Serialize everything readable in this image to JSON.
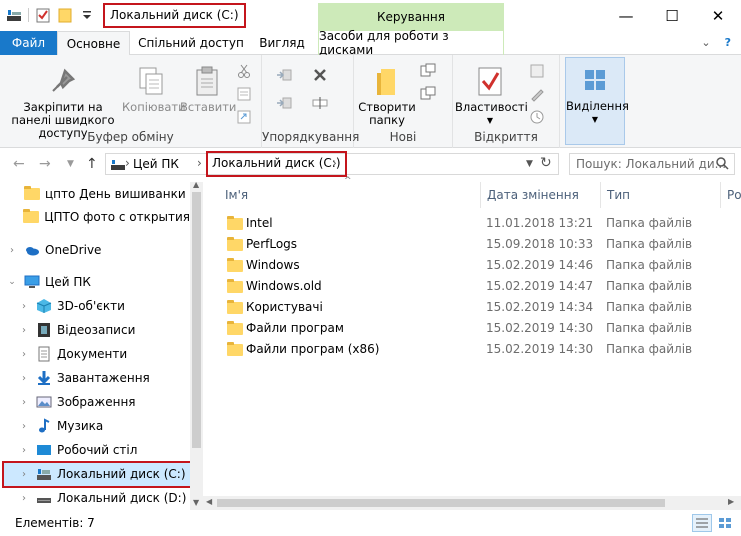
{
  "window": {
    "title": "Локальний диск (C:)",
    "context_tab_title": "Керування",
    "controls": {
      "minimize": "—",
      "maximize": "☐",
      "close": "✕"
    }
  },
  "ribbon_tabs": {
    "file": "Файл",
    "home": "Основне",
    "share": "Спільний доступ",
    "view": "Вигляд",
    "disk_tools": "Засоби для роботи з дисками",
    "collapse": "⌄",
    "help": "?"
  },
  "ribbon": {
    "clipboard": {
      "label": "Буфер обміну",
      "pin": "Закріпити на панелі швидкого доступу",
      "copy": "Копіювати",
      "paste": "Вставити"
    },
    "organize": {
      "label": "Упорядкування"
    },
    "new": {
      "label": "Нові",
      "new_folder": "Створити папку"
    },
    "open": {
      "label": "Відкриття",
      "properties": "Властивості"
    },
    "select": {
      "label": "Виділення"
    }
  },
  "address": {
    "root": "Цей ПК",
    "current": "Локальний диск (C:)",
    "search_placeholder": "Пошук: Локальний ди..."
  },
  "nav": {
    "items": [
      {
        "label": "цпто День вишиванки",
        "icon": "folder-icon"
      },
      {
        "label": "ЦПТО фото с открытия",
        "icon": "folder-icon"
      },
      {
        "label": "OneDrive",
        "icon": "onedrive-icon"
      },
      {
        "label": "Цей ПК",
        "icon": "pc-icon"
      },
      {
        "label": "3D-об'єкти",
        "icon": "3d-objects-icon"
      },
      {
        "label": "Відеозаписи",
        "icon": "video-icon"
      },
      {
        "label": "Документи",
        "icon": "documents-icon"
      },
      {
        "label": "Завантаження",
        "icon": "downloads-icon"
      },
      {
        "label": "Зображення",
        "icon": "pictures-icon"
      },
      {
        "label": "Музика",
        "icon": "music-icon"
      },
      {
        "label": "Робочий стіл",
        "icon": "desktop-icon"
      },
      {
        "label": "Локальний диск (C:)",
        "icon": "drive-c-icon"
      },
      {
        "label": "Локальний диск (D:)",
        "icon": "drive-d-icon"
      }
    ]
  },
  "files": {
    "columns": {
      "name": "Ім'я",
      "date": "Дата змінення",
      "type": "Тип",
      "size": "Ро"
    },
    "rows": [
      {
        "name": "Intel",
        "date": "11.01.2018 13:21",
        "type": "Папка файлів"
      },
      {
        "name": "PerfLogs",
        "date": "15.09.2018 10:33",
        "type": "Папка файлів"
      },
      {
        "name": "Windows",
        "date": "15.02.2019 14:46",
        "type": "Папка файлів"
      },
      {
        "name": "Windows.old",
        "date": "15.02.2019 14:47",
        "type": "Папка файлів"
      },
      {
        "name": "Користувачі",
        "date": "15.02.2019 14:34",
        "type": "Папка файлів"
      },
      {
        "name": "Файли програм",
        "date": "15.02.2019 14:30",
        "type": "Папка файлів"
      },
      {
        "name": "Файли програм (x86)",
        "date": "15.02.2019 14:30",
        "type": "Папка файлів"
      }
    ]
  },
  "status": {
    "count": "Елементів: 7"
  },
  "colors": {
    "accent": "#1979ca",
    "highlight": "#c4151c",
    "context_tab": "#cdeab9",
    "selection": "#cce8ff"
  }
}
